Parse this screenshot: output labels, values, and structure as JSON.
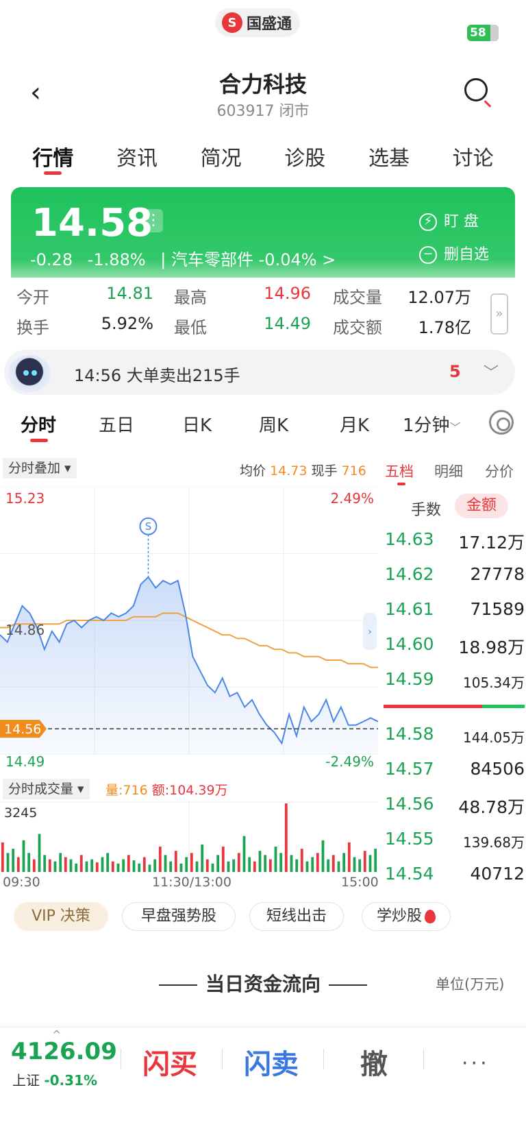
{
  "status_bar": {
    "app_logo_text": "国盛通",
    "battery": "58"
  },
  "header": {
    "title": "合力科技",
    "subtitle": "603917 闭市"
  },
  "tabs": [
    "行情",
    "资讯",
    "简况",
    "诊股",
    "选基",
    "讨论"
  ],
  "quote": {
    "price": "14.58",
    "change": "-0.28",
    "change_pct": "-1.88%",
    "sector_text": "| 汽车零部件 -0.04% >",
    "watch_label": "盯 盘",
    "unfav_label": "删自选"
  },
  "stats": [
    {
      "label": "今开",
      "value": "14.81",
      "color": "green"
    },
    {
      "label": "最高",
      "value": "14.96",
      "color": "red"
    },
    {
      "label": "成交量",
      "value": "12.07万",
      "color": "black"
    },
    {
      "label": "换手",
      "value": "5.92%",
      "color": "black"
    },
    {
      "label": "最低",
      "value": "14.49",
      "color": "green"
    },
    {
      "label": "成交额",
      "value": "1.78亿",
      "color": "black"
    }
  ],
  "alert": {
    "text": "14:56 大单卖出215手",
    "count": "5"
  },
  "period_tabs": [
    "分时",
    "五日",
    "日K",
    "周K",
    "月K",
    "1分钟"
  ],
  "overlay": {
    "chip": "分时叠加 ▾",
    "avg_label": "均价",
    "avg_value": "14.73",
    "hand_label": "现手",
    "hand_value": "716"
  },
  "orderbook": {
    "tabs": [
      "五档",
      "明细",
      "分价"
    ],
    "head_qty": "手数",
    "head_amt": "金额",
    "asks": [
      {
        "price": "14.63",
        "vol": "17.12万"
      },
      {
        "price": "14.62",
        "vol": "27778"
      },
      {
        "price": "14.61",
        "vol": "71589"
      },
      {
        "price": "14.60",
        "vol": "18.98万"
      },
      {
        "price": "14.59",
        "vol": "105.34万"
      }
    ],
    "bids": [
      {
        "price": "14.58",
        "vol": "144.05万"
      },
      {
        "price": "14.57",
        "vol": "84506"
      },
      {
        "price": "14.56",
        "vol": "48.78万"
      },
      {
        "price": "14.55",
        "vol": "139.68万"
      },
      {
        "price": "14.54",
        "vol": "40712"
      }
    ],
    "buy_ratio": 0.7
  },
  "chart_data": {
    "type": "line",
    "y_max_label": "15.23",
    "y_mid_label": "14.86",
    "y_min_label": "14.49",
    "pct_max_label": "2.49%",
    "pct_min_label": "-2.49%",
    "last_price_tag": "14.56",
    "signal_marker": "S",
    "ylim": [
      14.49,
      15.23
    ],
    "x_labels": [
      "09:30",
      "11:30/13:00",
      "15:00"
    ],
    "series": [
      {
        "values": [
          14.82,
          14.8,
          14.85,
          14.9,
          14.88,
          14.84,
          14.78,
          14.83,
          14.8,
          14.85,
          14.86,
          14.84,
          14.86,
          14.87,
          14.86,
          14.88,
          14.87,
          14.88,
          14.9,
          14.96,
          14.98,
          14.95,
          14.97,
          14.96,
          14.97,
          14.88,
          14.76,
          14.72,
          14.68,
          14.66,
          14.7,
          14.65,
          14.66,
          14.62,
          14.64,
          14.6,
          14.57,
          14.55,
          14.52,
          14.6,
          14.54,
          14.62,
          14.58,
          14.6,
          14.64,
          14.58,
          14.62,
          14.57,
          14.57,
          14.58,
          14.59,
          14.58
        ]
      },
      {
        "values": [
          14.84,
          14.84,
          14.85,
          14.85,
          14.85,
          14.85,
          14.85,
          14.85,
          14.85,
          14.86,
          14.86,
          14.86,
          14.86,
          14.86,
          14.86,
          14.86,
          14.86,
          14.86,
          14.87,
          14.87,
          14.87,
          14.87,
          14.88,
          14.88,
          14.88,
          14.87,
          14.86,
          14.85,
          14.84,
          14.83,
          14.82,
          14.82,
          14.81,
          14.81,
          14.8,
          14.79,
          14.79,
          14.78,
          14.78,
          14.77,
          14.77,
          14.76,
          14.76,
          14.76,
          14.75,
          14.75,
          14.75,
          14.74,
          14.74,
          14.74,
          14.73,
          14.73
        ]
      }
    ]
  },
  "volume": {
    "chip": "分时成交量 ▾",
    "qty_text": "量:716",
    "amt_text": "额:104.39万",
    "max_label": "3245",
    "values": [
      1400,
      900,
      1100,
      700,
      1500,
      900,
      600,
      1800,
      800,
      600,
      500,
      900,
      700,
      600,
      400,
      800,
      500,
      600,
      450,
      700,
      900,
      500,
      400,
      600,
      800,
      550,
      400,
      700,
      350,
      600,
      1200,
      800,
      500,
      1000,
      400,
      700,
      900,
      500,
      1300,
      600,
      400,
      800,
      1200,
      500,
      600,
      900,
      1700,
      700,
      500,
      1000,
      800,
      600,
      1200,
      900,
      3245,
      800,
      600,
      1100,
      500,
      700,
      900,
      1500,
      600,
      800,
      500,
      900,
      1400,
      700,
      600,
      1000,
      800,
      1100
    ]
  },
  "quick_links": [
    "VIP 决策",
    "早盘强势股",
    "短线出击",
    "学炒股"
  ],
  "section": {
    "title": "当日资金流向",
    "unit": "单位(万元)"
  },
  "bottom": {
    "index_value": "4126.09",
    "index_name": "上证",
    "index_change": "-0.31%",
    "buy": "闪买",
    "sell": "闪卖",
    "cancel": "撤",
    "more": "···"
  },
  "colors": {
    "up": "#e8363b",
    "down": "#1aa352",
    "price_line": "#4a86e8",
    "avg_line": "#f0a040"
  }
}
